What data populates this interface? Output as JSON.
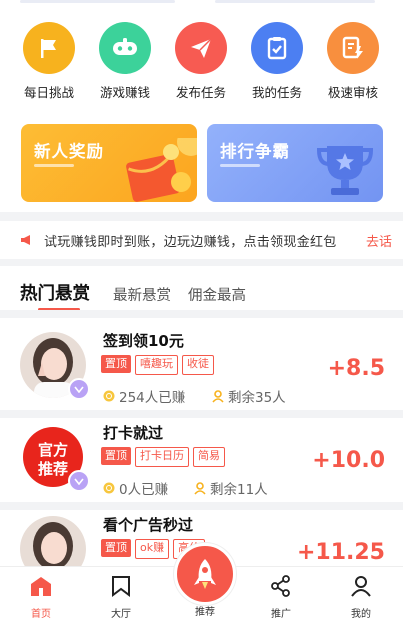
{
  "quick_icons": [
    {
      "label": "每日挑战",
      "icon": "flag-icon",
      "color": "#f7b21e"
    },
    {
      "label": "游戏赚钱",
      "icon": "gamepad-icon",
      "color": "#3cd29a"
    },
    {
      "label": "发布任务",
      "icon": "paper-plane-icon",
      "color": "#f75b52"
    },
    {
      "label": "我的任务",
      "icon": "clipboard-check-icon",
      "color": "#4c7ff2"
    },
    {
      "label": "极速审核",
      "icon": "document-lightning-icon",
      "color": "#f88f3e"
    }
  ],
  "banners": [
    {
      "title": "新人奖励",
      "color": "#fdb52b",
      "icon": "red-envelope-icon"
    },
    {
      "title": "排行争霸",
      "color": "#7d9ff7",
      "icon": "trophy-icon"
    }
  ],
  "notice": {
    "text": "试玩赚钱即时到账，边玩边赚钱，点击领现金红包",
    "link": "去话",
    "icon": "megaphone-icon"
  },
  "tabs": [
    "热门悬赏",
    "最新悬赏",
    "佣金最高"
  ],
  "tasks": [
    {
      "title": "签到领10元",
      "tags": [
        "置顶",
        "嘻趣玩",
        "收徒"
      ],
      "earned": "254人已赚",
      "remaining": "剩余35人",
      "reward": "+8.5",
      "avatar": "girl-photo"
    },
    {
      "title": "打卡就过",
      "tags": [
        "置顶",
        "打卡日历",
        "简易"
      ],
      "earned": "0人已赚",
      "remaining": "剩余11人",
      "reward": "+10.0",
      "avatar": "official-recommend-badge",
      "avatar_text": "官方推荐"
    },
    {
      "title": "看个广告秒过",
      "tags": [
        "置顶",
        "ok赚",
        "高价"
      ],
      "earned": "",
      "remaining": "",
      "reward": "+11.25",
      "avatar": "girl-photo"
    }
  ],
  "nav": [
    {
      "label": "首页",
      "icon": "home-icon",
      "active": true
    },
    {
      "label": "大厅",
      "icon": "bookmark-icon",
      "active": false
    },
    {
      "label": "推荐",
      "icon": "rocket-icon",
      "active": false
    },
    {
      "label": "推广",
      "icon": "share-icon",
      "active": false
    },
    {
      "label": "我的",
      "icon": "user-icon",
      "active": false
    }
  ]
}
